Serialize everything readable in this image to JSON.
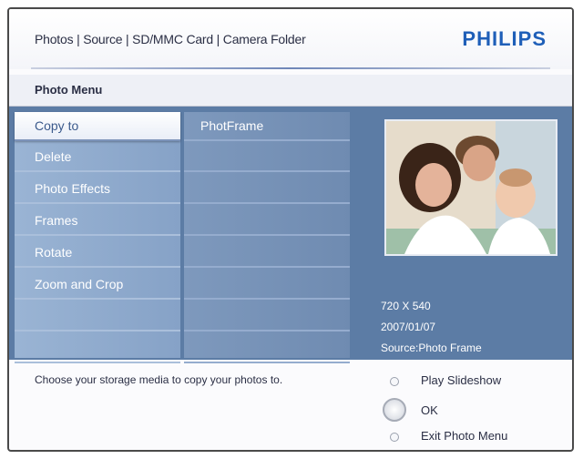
{
  "header": {
    "breadcrumb": "Photos | Source | SD/MMC Card | Camera Folder",
    "brand": "PHILIPS"
  },
  "title_bar": {
    "title": "Photo Menu"
  },
  "menu": {
    "items": [
      {
        "label": "Copy to",
        "selected": true
      },
      {
        "label": "Delete"
      },
      {
        "label": "Photo Effects"
      },
      {
        "label": "Frames"
      },
      {
        "label": "Rotate"
      },
      {
        "label": "Zoom and Crop"
      },
      {
        "label": ""
      },
      {
        "label": ""
      }
    ]
  },
  "submenu": {
    "items": [
      {
        "label": "PhotFrame",
        "enabled": true
      },
      {
        "label": "",
        "enabled": false
      },
      {
        "label": "",
        "enabled": false
      },
      {
        "label": "",
        "enabled": false
      },
      {
        "label": "",
        "enabled": false
      },
      {
        "label": "",
        "enabled": false
      },
      {
        "label": "",
        "enabled": false
      },
      {
        "label": "",
        "enabled": false
      }
    ]
  },
  "preview": {
    "resolution": "720 X 540",
    "date": "2007/01/07",
    "source": "Source:Photo Frame"
  },
  "footer": {
    "hint": "Choose your storage media to copy your photos to.",
    "options": [
      {
        "label": "Play Slideshow"
      },
      {
        "label": "OK"
      },
      {
        "label": "Exit Photo Menu"
      }
    ]
  },
  "colors": {
    "brand": "#1f5fb8",
    "panel": "#5c7ca5"
  }
}
